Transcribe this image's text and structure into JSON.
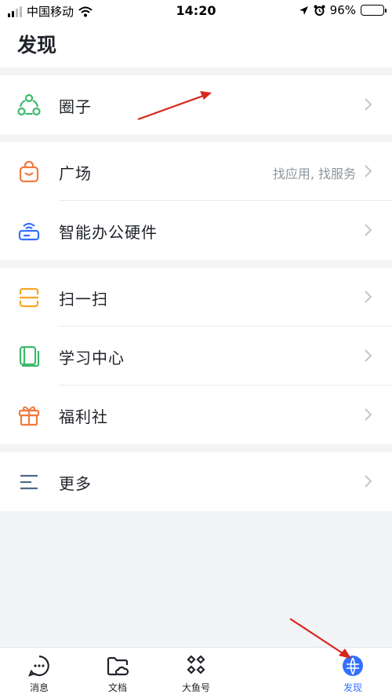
{
  "status_bar": {
    "carrier": "中国移动",
    "time": "14:20",
    "battery_percent": "96%",
    "battery_level": 0.96
  },
  "header": {
    "title": "发现"
  },
  "groups": [
    {
      "items": [
        {
          "label": "圈子",
          "icon": "circle-network-icon",
          "hint": ""
        }
      ]
    },
    {
      "items": [
        {
          "label": "广场",
          "icon": "shopping-bag-icon",
          "hint": "找应用, 找服务"
        },
        {
          "label": "智能办公硬件",
          "icon": "router-device-icon",
          "hint": ""
        }
      ]
    },
    {
      "items": [
        {
          "label": "扫一扫",
          "icon": "scan-icon",
          "hint": ""
        },
        {
          "label": "学习中心",
          "icon": "book-icon",
          "hint": ""
        },
        {
          "label": "福利社",
          "icon": "gift-icon",
          "hint": ""
        }
      ]
    },
    {
      "items": [
        {
          "label": "更多",
          "icon": "menu-lines-icon",
          "hint": ""
        }
      ]
    }
  ],
  "tabbar": {
    "tabs": [
      {
        "label": "消息",
        "icon": "chat-bubble-icon"
      },
      {
        "label": "文档",
        "icon": "folder-cloud-icon"
      },
      {
        "label": "大鱼号",
        "icon": "grid-app-icon"
      },
      {
        "label": "发现",
        "icon": "discover-globe-icon",
        "active": true
      }
    ]
  },
  "colors": {
    "accent_blue": "#3370ff",
    "circle_green": "#3dba6b",
    "bag_orange": "#f07b3f",
    "device_blue": "#3370ff",
    "scan_amber": "#f5a623",
    "book_green": "#3dba6b",
    "gift_orange": "#f07b3f",
    "menu_slate": "#4e6a85",
    "annotation_red": "#d9261c"
  }
}
